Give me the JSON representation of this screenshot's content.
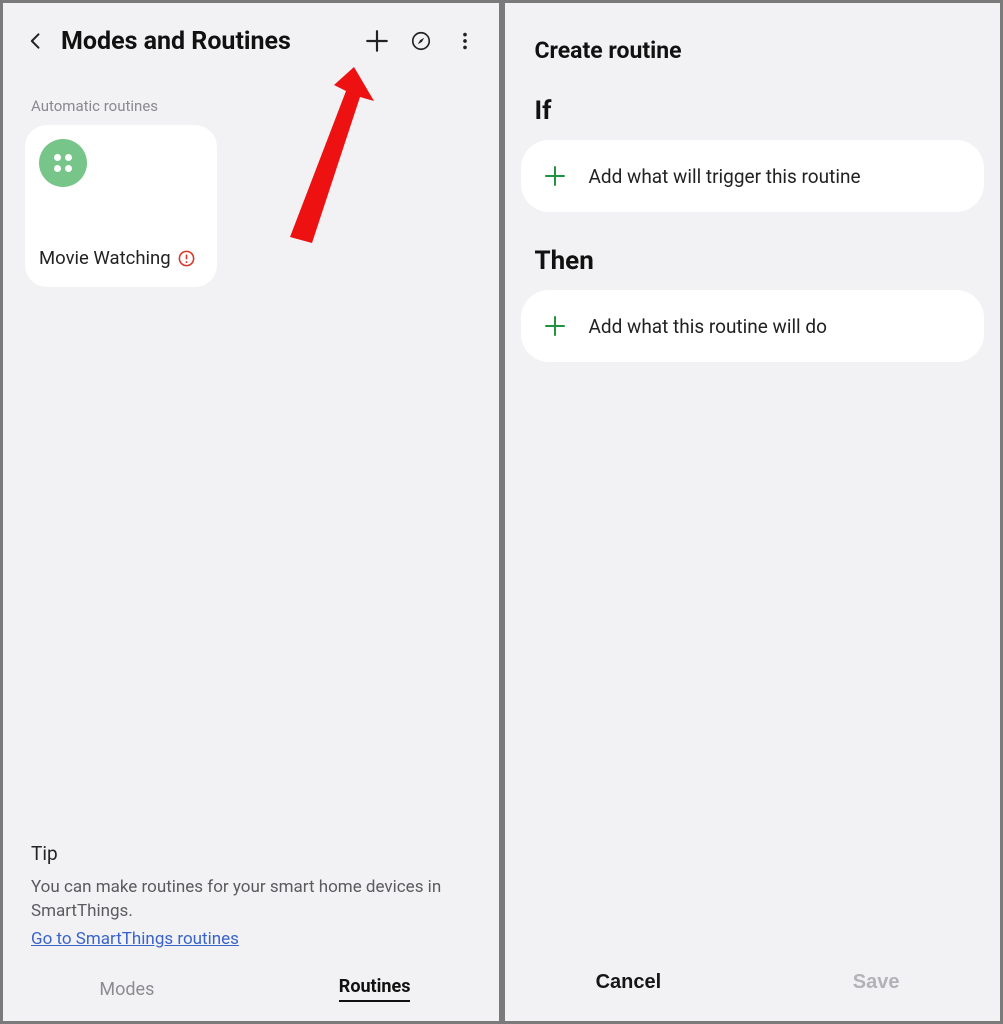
{
  "left": {
    "header": {
      "title": "Modes and Routines"
    },
    "section_label": "Automatic routines",
    "routines": [
      {
        "name": "Movie Watching"
      }
    ],
    "tip": {
      "title": "Tip",
      "body": "You can make routines for your smart home devices in SmartThings.",
      "link_text": "Go to SmartThings routines"
    },
    "tabs": {
      "modes": "Modes",
      "routines": "Routines",
      "active": "routines"
    }
  },
  "right": {
    "title": "Create routine",
    "if_label": "If",
    "if_add_text": "Add what will trigger this routine",
    "then_label": "Then",
    "then_add_text": "Add what this routine will do",
    "cancel": "Cancel",
    "save": "Save"
  }
}
